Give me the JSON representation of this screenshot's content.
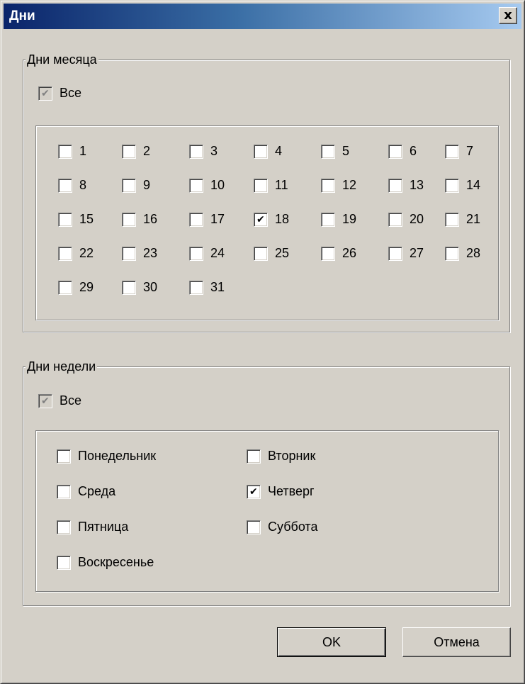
{
  "window": {
    "title": "Дни",
    "close_symbol": "x"
  },
  "month_group": {
    "label": "Дни месяца",
    "all": {
      "label": "Все",
      "checked": true,
      "disabled": true
    },
    "days": [
      {
        "label": "1",
        "checked": false
      },
      {
        "label": "2",
        "checked": false
      },
      {
        "label": "3",
        "checked": false
      },
      {
        "label": "4",
        "checked": false
      },
      {
        "label": "5",
        "checked": false
      },
      {
        "label": "6",
        "checked": false
      },
      {
        "label": "7",
        "checked": false
      },
      {
        "label": "8",
        "checked": false
      },
      {
        "label": "9",
        "checked": false
      },
      {
        "label": "10",
        "checked": false
      },
      {
        "label": "11",
        "checked": false
      },
      {
        "label": "12",
        "checked": false
      },
      {
        "label": "13",
        "checked": false
      },
      {
        "label": "14",
        "checked": false
      },
      {
        "label": "15",
        "checked": false
      },
      {
        "label": "16",
        "checked": false
      },
      {
        "label": "17",
        "checked": false
      },
      {
        "label": "18",
        "checked": true
      },
      {
        "label": "19",
        "checked": false
      },
      {
        "label": "20",
        "checked": false
      },
      {
        "label": "21",
        "checked": false
      },
      {
        "label": "22",
        "checked": false
      },
      {
        "label": "23",
        "checked": false
      },
      {
        "label": "24",
        "checked": false
      },
      {
        "label": "25",
        "checked": false
      },
      {
        "label": "26",
        "checked": false
      },
      {
        "label": "27",
        "checked": false
      },
      {
        "label": "28",
        "checked": false
      },
      {
        "label": "29",
        "checked": false
      },
      {
        "label": "30",
        "checked": false
      },
      {
        "label": "31",
        "checked": false
      }
    ]
  },
  "week_group": {
    "label": "Дни недели",
    "all": {
      "label": "Все",
      "checked": true,
      "disabled": true
    },
    "days": [
      {
        "label": "Понедельник",
        "checked": false
      },
      {
        "label": "Вторник",
        "checked": false
      },
      {
        "label": "Среда",
        "checked": false
      },
      {
        "label": "Четверг",
        "checked": true
      },
      {
        "label": "Пятница",
        "checked": false
      },
      {
        "label": "Суббота",
        "checked": false
      },
      {
        "label": "Воскресенье",
        "checked": false
      }
    ]
  },
  "buttons": {
    "ok": "OK",
    "cancel": "Отмена"
  },
  "check_glyph": "✔"
}
